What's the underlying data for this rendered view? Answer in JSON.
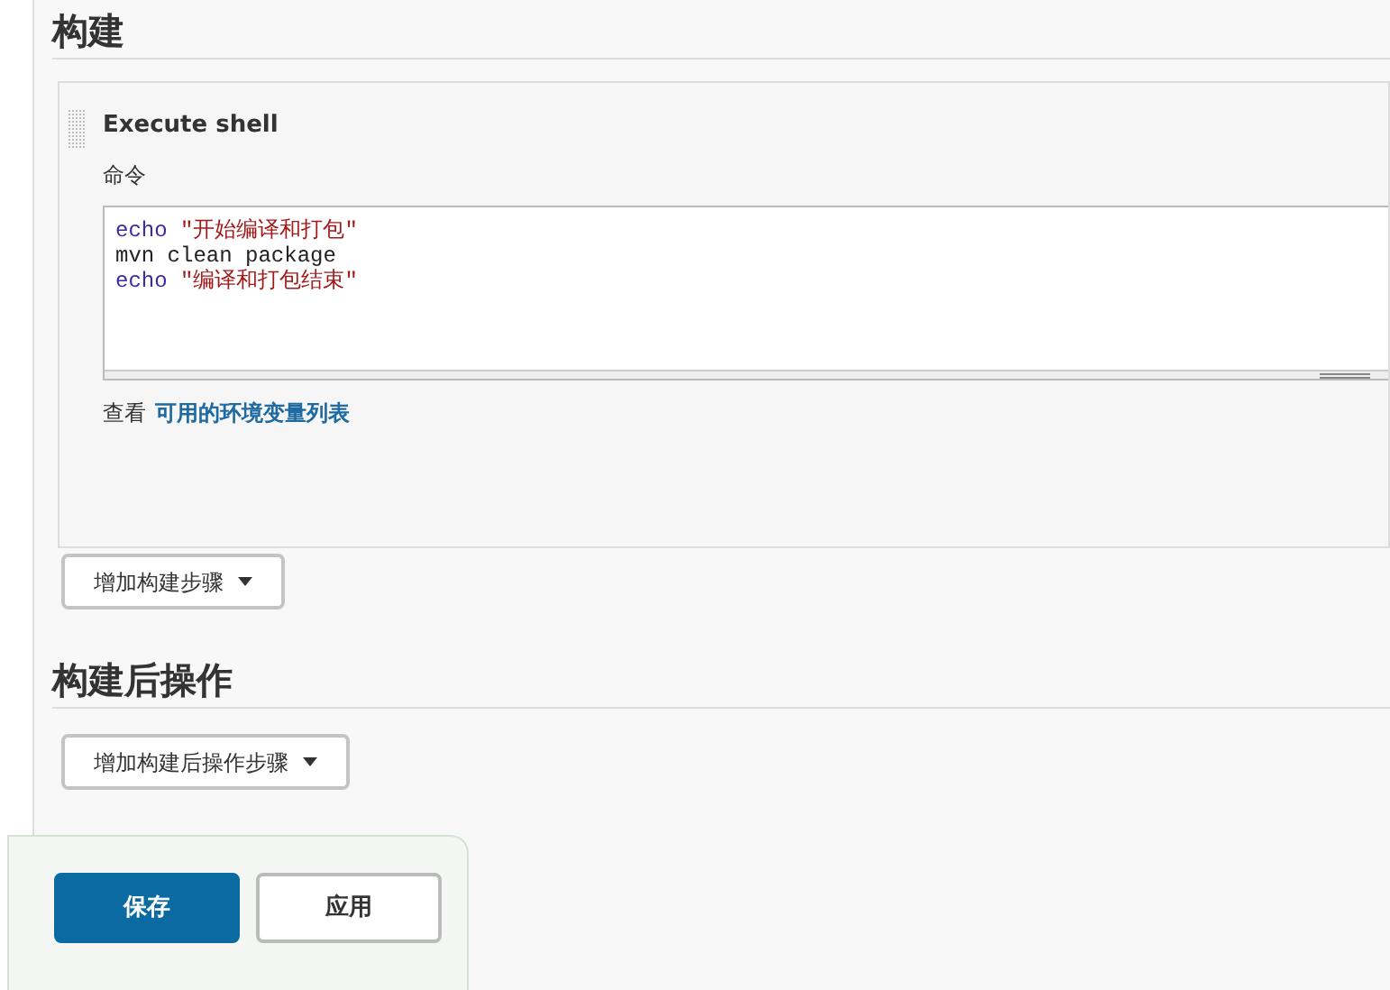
{
  "build_section": {
    "title": "构建",
    "step": {
      "title": "Execute shell",
      "command_label": "命令",
      "code_lines": [
        [
          {
            "kind": "keyword",
            "text": "echo"
          },
          {
            "kind": "string",
            "text": " \"开始编译和打包\""
          }
        ],
        [
          {
            "kind": "plain",
            "text": "mvn clean package"
          }
        ],
        [
          {
            "kind": "keyword",
            "text": "echo"
          },
          {
            "kind": "string",
            "text": " \"编译和打包结束\""
          }
        ]
      ],
      "help_prefix": "查看",
      "help_link": "可用的环境变量列表"
    },
    "add_button": "增加构建步骤"
  },
  "post_build_section": {
    "title": "构建后操作",
    "add_button": "增加构建后操作步骤"
  },
  "footer": {
    "buttons": [
      {
        "kind": "primary",
        "label": "保存"
      },
      {
        "kind": "secondary",
        "label": "应用"
      }
    ]
  }
}
